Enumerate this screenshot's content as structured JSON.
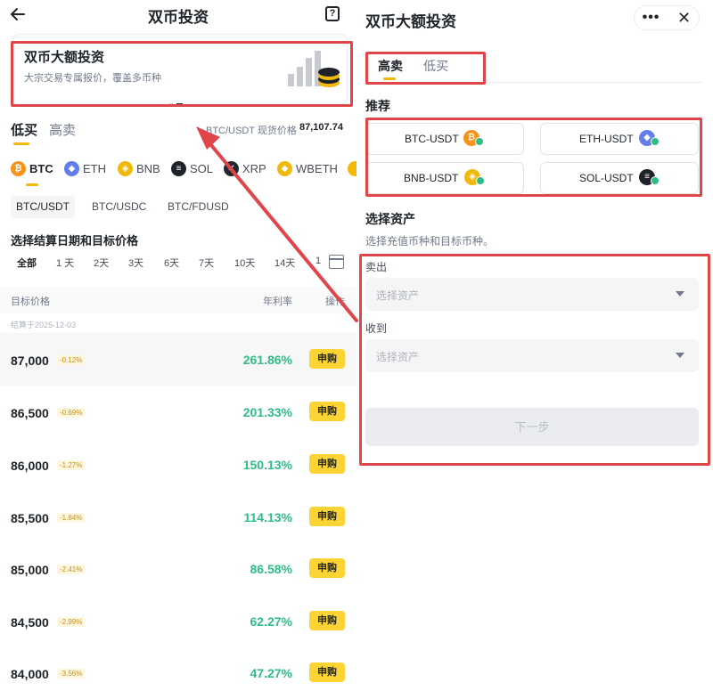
{
  "left": {
    "title": "双币投资",
    "help_glyph": "?",
    "banner": {
      "title": "双币大额投资",
      "subtitle": "大宗交易专属报价，覆盖多币种"
    },
    "tabs": [
      "低买",
      "高卖"
    ],
    "price_label": "BTC/USDT 现货价格",
    "price_value": "87,107.74",
    "coins": [
      {
        "label": "BTC",
        "glyph": "₿",
        "color": "#f7931a"
      },
      {
        "label": "ETH",
        "glyph": "◆",
        "color": "#627eea"
      },
      {
        "label": "BNB",
        "glyph": "◈",
        "color": "#f0b90b"
      },
      {
        "label": "SOL",
        "glyph": "≡",
        "color": "#1e2329"
      },
      {
        "label": "XRP",
        "glyph": "✕",
        "color": "#23292f"
      },
      {
        "label": "WBETH",
        "glyph": "◆",
        "color": "#f0b90b"
      }
    ],
    "pairs": [
      "BTC/USDT",
      "BTC/USDC",
      "BTC/FDUSD"
    ],
    "section_title": "选择结算日期和目标价格",
    "days": [
      "全部",
      "1 天",
      "2天",
      "3天",
      "6天",
      "7天",
      "10天",
      "14天",
      "1"
    ],
    "table_headers": {
      "target": "目标价格",
      "rate": "年利率",
      "action": "操作"
    },
    "settle_date": "结算于2025-12-03",
    "rows": [
      {
        "price": "87,000",
        "pct": "-0.12%",
        "rate": "261.86%",
        "btn": "申购"
      },
      {
        "price": "86,500",
        "pct": "-0.69%",
        "rate": "201.33%",
        "btn": "申购"
      },
      {
        "price": "86,000",
        "pct": "-1.27%",
        "rate": "150.13%",
        "btn": "申购"
      },
      {
        "price": "85,500",
        "pct": "-1.84%",
        "rate": "114.13%",
        "btn": "申购"
      },
      {
        "price": "85,000",
        "pct": "-2.41%",
        "rate": "86.58%",
        "btn": "申购"
      },
      {
        "price": "84,500",
        "pct": "-2.99%",
        "rate": "62.27%",
        "btn": "申购"
      },
      {
        "price": "84,000",
        "pct": "-3.56%",
        "rate": "47.27%",
        "btn": "申购"
      }
    ]
  },
  "right": {
    "title": "双币大额投资",
    "more_glyph": "•••",
    "close_glyph": "✕",
    "tabs": [
      "高卖",
      "低买"
    ],
    "recommend_title": "推荐",
    "recommend": [
      {
        "label": "BTC-USDT",
        "glyph": "₿",
        "color": "#f7931a"
      },
      {
        "label": "ETH-USDT",
        "glyph": "◆",
        "color": "#627eea"
      },
      {
        "label": "BNB-USDT",
        "glyph": "◈",
        "color": "#f0b90b"
      },
      {
        "label": "SOL-USDT",
        "glyph": "≡",
        "color": "#1e2329"
      }
    ],
    "asset_title": "选择资产",
    "asset_subtitle": "选择充值币种和目标币种。",
    "sell_label": "卖出",
    "receive_label": "收到",
    "select_placeholder": "选择资产",
    "next_label": "下一步"
  },
  "colors": {
    "accent": "#f0b90b",
    "button_yellow": "#fcd535",
    "positive": "#2ebd85",
    "annotation_red": "#e0454a"
  }
}
